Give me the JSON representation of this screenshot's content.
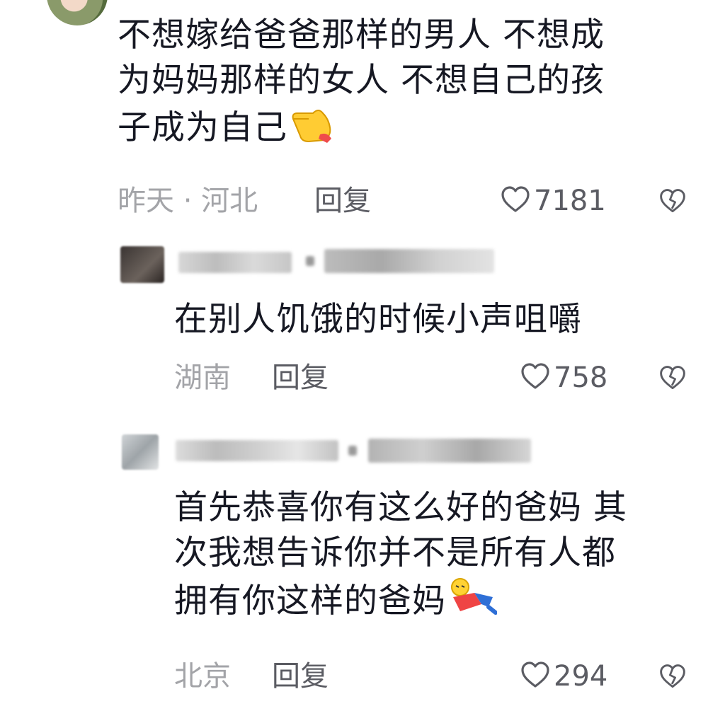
{
  "comments": [
    {
      "text_lines": [
        "不想嫁给爸爸那样的男人 不想成",
        "为妈妈那样的女人 不想自己的孩",
        "子成为自己"
      ],
      "emoji": "pointing-hand-emoji",
      "meta": "昨天 · 河北",
      "reply": "回复",
      "likes": "7181"
    },
    {
      "username_blurred": "我是离…",
      "text_lines": [
        "在别人饥饿的时候小声咀嚼"
      ],
      "meta": "湖南",
      "reply": "回复",
      "likes": "758"
    },
    {
      "text_lines": [
        "首先恭喜你有这么好的爸妈 其",
        "次我想告诉你并不是所有人都",
        "拥有你这样的爸妈"
      ],
      "emoji": "fallen-figure-emoji",
      "meta": "北京",
      "reply": "回复",
      "likes": "294"
    }
  ],
  "colors": {
    "text": "#161823",
    "meta": "#a3a4a8",
    "action": "#5b5c63"
  }
}
